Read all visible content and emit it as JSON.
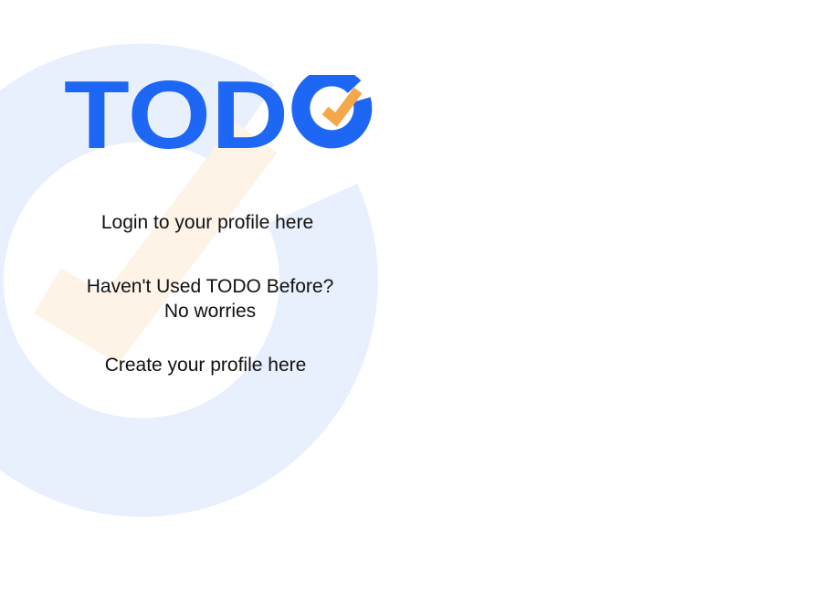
{
  "logo": {
    "text": "TOD",
    "brand_color": "#1e67f5",
    "check_color": "#f4a84a"
  },
  "background": {
    "ring_color": "#e8effd",
    "check_color": "#fdf3e6"
  },
  "auth": {
    "login_link": "Login to your profile here",
    "promo_line1": "Haven't Used TODO Before?",
    "promo_line2": "No worries",
    "create_link": "Create your profile here"
  }
}
